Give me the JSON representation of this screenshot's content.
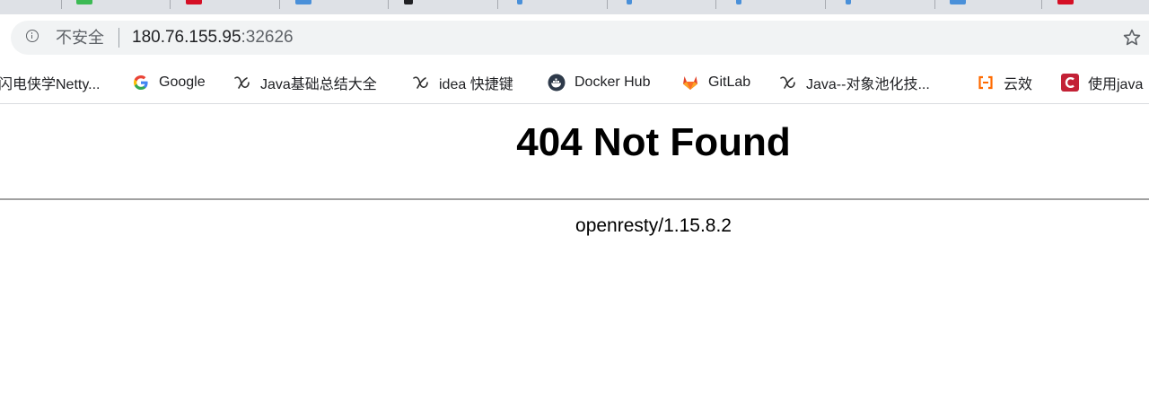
{
  "address_bar": {
    "security_label": "不安全",
    "url_host": "180.76.155.95",
    "url_port": ":32626"
  },
  "bookmarks": [
    {
      "label": "闪电侠学Netty...",
      "icon": "none"
    },
    {
      "label": "Google",
      "icon": "google-icon"
    },
    {
      "label": "Java基础总结大全",
      "icon": "yuque-icon"
    },
    {
      "label": "idea 快捷键",
      "icon": "yuque-icon"
    },
    {
      "label": "Docker Hub",
      "icon": "docker-icon"
    },
    {
      "label": "GitLab",
      "icon": "gitlab-icon"
    },
    {
      "label": "Java--对象池化技...",
      "icon": "yuque-icon"
    },
    {
      "label": "云效",
      "icon": "aliyun-icon"
    },
    {
      "label": "使用java",
      "icon": "csdn-icon"
    }
  ],
  "page": {
    "title": "404 Not Found",
    "server": "openresty/1.15.8.2"
  },
  "colors": {
    "tab_strip": "#dee1e6",
    "omnibox": "#f1f3f4",
    "gitlab": "#e24329",
    "aliyun": "#ff6a00",
    "csdn": "#c32136",
    "docker": "#2e3a4a"
  }
}
